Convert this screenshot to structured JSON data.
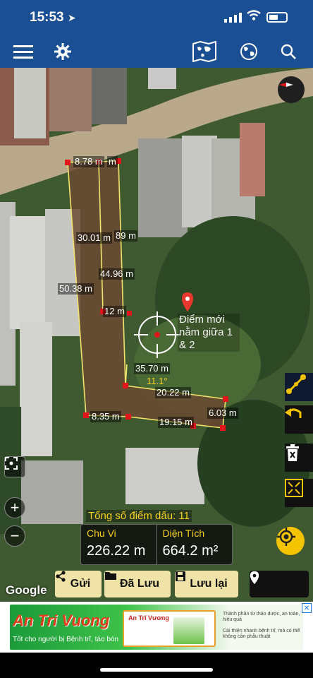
{
  "status_bar": {
    "time": "15:53"
  },
  "map": {
    "pin_label": "Điểm mới nằm giữa 1 & 2",
    "measurements": [
      "8.78 m",
      "m",
      "30.01 m",
      "89 m",
      "44.96 m",
      "50.38 m",
      "12 m",
      "35.70 m",
      "11.1°",
      "20.22 m",
      "6.03 m",
      "8.35 m",
      "19.15 m"
    ],
    "zoom_in": "+",
    "zoom_out": "−"
  },
  "summary": {
    "points_label": "Tổng số điểm dấu: 11",
    "perimeter_label": "Chu Vi",
    "perimeter_value": "226.22 m",
    "area_label": "Diện Tích",
    "area_value": "664.2 m²"
  },
  "attribution": "Google",
  "actions": {
    "send": "Gửi",
    "saved": "Đã Lưu",
    "save": "Lưu lại"
  },
  "ad": {
    "brand": "An Tri Vuong",
    "slogan": "Tốt cho người bị Bệnh trĩ, táo bón",
    "package_title": "An Trĩ Vương",
    "bullets": [
      "Thành phần từ thảo dược, an toàn, hiệu quả",
      "Cải thiện nhanh bệnh trĩ, mà có thể không cần phẫu thuật"
    ]
  },
  "colors": {
    "header": "#1a4f93",
    "accent": "#f5c400",
    "line": "#f3e36c",
    "point": "#e0161b"
  }
}
